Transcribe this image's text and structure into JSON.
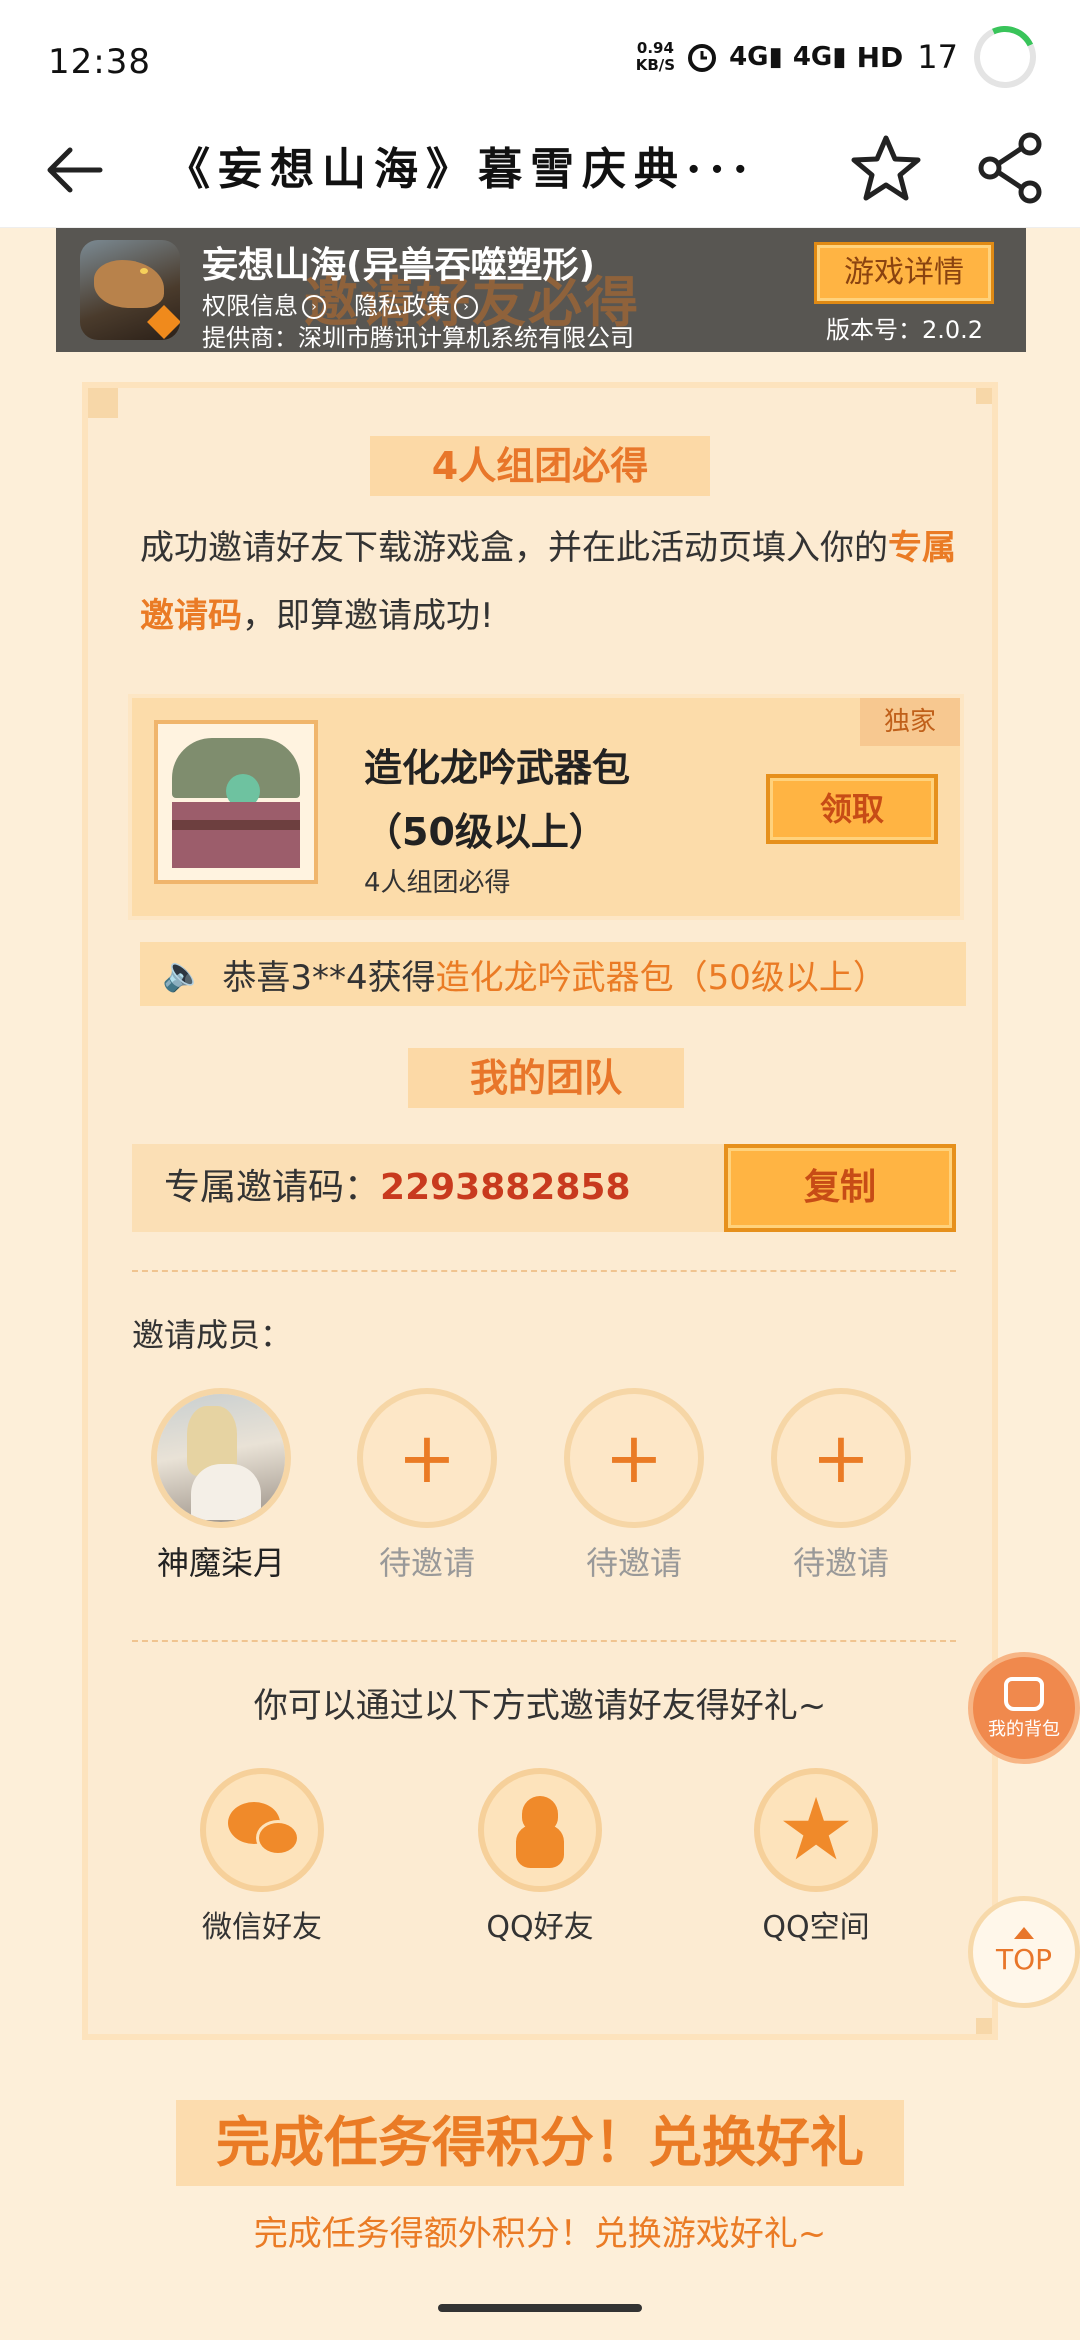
{
  "status_bar": {
    "time": "12:38",
    "net_speed_value": "0.94",
    "net_speed_unit": "KB/S",
    "signal_1": "4G",
    "signal_2": "4G",
    "hd": "HD",
    "battery": "17"
  },
  "header": {
    "title": "《妄想山海》暮雪庆典···",
    "icons": [
      "back-arrow-icon",
      "star-icon",
      "share-icon"
    ]
  },
  "game_banner": {
    "name": "妄想山海(异兽吞噬塑形)",
    "permission_label": "权限信息",
    "privacy_label": "隐私政策",
    "provider": "提供商：深圳市腾讯计算机系统有限公司",
    "detail_button": "游戏详情",
    "version": "版本号：2.0.2",
    "background_text": "邀请好友必得"
  },
  "team_section": {
    "title": "4人组团必得",
    "desc_part1": "成功邀请好友下载游戏盒，并在此活动页填入你的",
    "desc_highlight": "专属邀请码",
    "desc_part2": "，即算邀请成功!",
    "reward": {
      "tag": "独家",
      "name": "造化龙吟武器包（50级以上）",
      "sub": "4人组团必得",
      "claim_button": "领取"
    },
    "congrats": {
      "prefix": "恭喜3**4获得",
      "prize": "造化龙吟武器包（50级以上）"
    }
  },
  "my_team": {
    "title": "我的团队",
    "invite_label": "专属邀请码：",
    "invite_code": "2293882858",
    "copy_button": "复制",
    "members_label": "邀请成员：",
    "members": [
      {
        "name": "神魔柒月"
      },
      {
        "name": "待邀请"
      },
      {
        "name": "待邀请"
      },
      {
        "name": "待邀请"
      }
    ]
  },
  "share": {
    "title": "你可以通过以下方式邀请好友得好礼~",
    "options": [
      {
        "label": "微信好友",
        "icon": "wechat-icon"
      },
      {
        "label": "QQ好友",
        "icon": "qq-icon"
      },
      {
        "label": "QQ空间",
        "icon": "qzone-icon"
      }
    ]
  },
  "bottom": {
    "title": "完成任务得积分！兑换好礼",
    "subtitle": "完成任务得额外积分！兑换游戏好礼~"
  },
  "floating": {
    "bag_label": "我的背包",
    "top_label": "TOP"
  },
  "colors": {
    "accent": "#ea7b25",
    "page_bg": "#fdefd9",
    "card_bg": "#fcebd2",
    "button_bg": "#ffb443",
    "code_red": "#c83a1e"
  }
}
